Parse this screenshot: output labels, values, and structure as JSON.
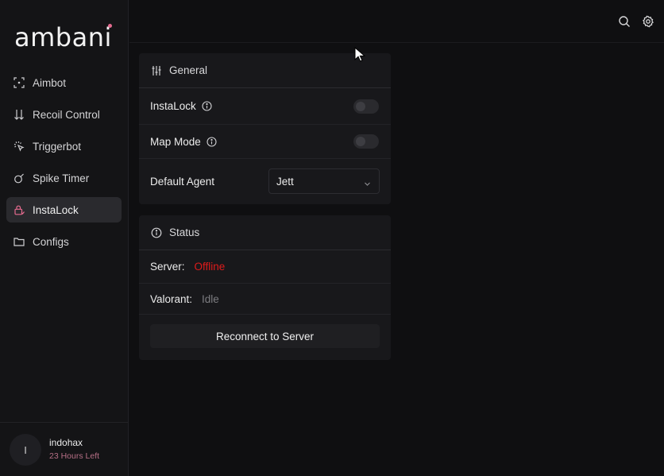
{
  "app": {
    "logo_text": "ambani",
    "accent_color": "#e56b8f"
  },
  "sidebar": {
    "items": [
      {
        "label": "Aimbot",
        "icon": "crosshair-icon",
        "active": false
      },
      {
        "label": "Recoil Control",
        "icon": "arrows-down-icon",
        "active": false
      },
      {
        "label": "Triggerbot",
        "icon": "click-icon",
        "active": false
      },
      {
        "label": "Spike Timer",
        "icon": "bomb-icon",
        "active": false
      },
      {
        "label": "InstaLock",
        "icon": "lock-icon",
        "active": true
      },
      {
        "label": "Configs",
        "icon": "folder-icon",
        "active": false
      }
    ]
  },
  "user": {
    "avatar_initial": "I",
    "name": "indohax",
    "status": "23 Hours Left",
    "status_color": "#b66f86"
  },
  "topbar": {
    "icons": [
      "search-icon",
      "gear-icon"
    ]
  },
  "general": {
    "title": "General",
    "instalock_label": "InstaLock",
    "instalock_on": false,
    "mapmode_label": "Map Mode",
    "mapmode_on": false,
    "default_agent_label": "Default Agent",
    "default_agent_value": "Jett"
  },
  "status": {
    "title": "Status",
    "server_label": "Server:",
    "server_value": "Offline",
    "server_color": "#e01b1b",
    "valorant_label": "Valorant:",
    "valorant_value": "Idle",
    "reconnect_label": "Reconnect to Server"
  }
}
